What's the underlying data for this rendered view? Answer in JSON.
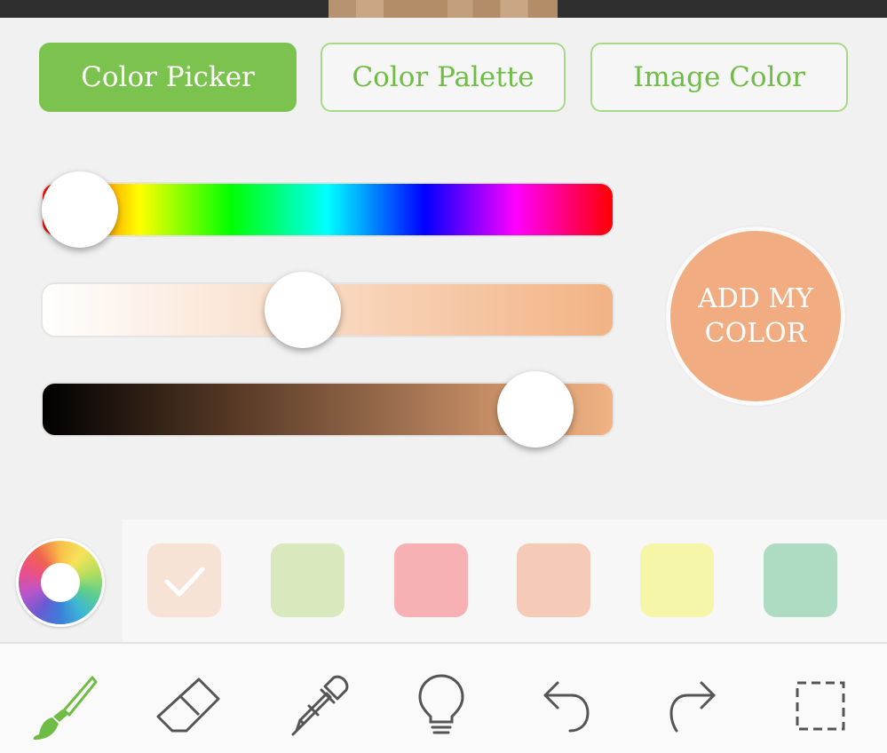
{
  "tabs": [
    {
      "label": "Color Picker",
      "active": true
    },
    {
      "label": "Color Palette",
      "active": false
    },
    {
      "label": "Image Color",
      "active": false
    }
  ],
  "sliders": {
    "hue": {
      "value": 0.0
    },
    "saturation": {
      "value": 0.45
    },
    "brightness": {
      "value": 0.92
    }
  },
  "selected_color": "#f1ad81",
  "add_button": {
    "label_line1": "ADD MY",
    "label_line2": "COLOR"
  },
  "palette": {
    "swatches": [
      {
        "color": "#f6e3d6",
        "selected": true
      },
      {
        "color": "#d9e8bd",
        "selected": false
      },
      {
        "color": "#f7b1b5",
        "selected": false
      },
      {
        "color": "#f5cbb8",
        "selected": false
      },
      {
        "color": "#f6f6a8",
        "selected": false
      },
      {
        "color": "#addcc3",
        "selected": false
      }
    ]
  },
  "toolbar": {
    "tools": [
      {
        "icon": "brush-icon",
        "active": true
      },
      {
        "icon": "eraser-icon",
        "active": false
      },
      {
        "icon": "eyedropper-icon",
        "active": false
      },
      {
        "icon": "lightbulb-icon",
        "active": false
      },
      {
        "icon": "undo-icon",
        "active": false
      },
      {
        "icon": "redo-icon",
        "active": false
      },
      {
        "icon": "select-area-icon",
        "active": false
      }
    ]
  },
  "colors": {
    "accent": "#7cc24f",
    "icon": "#555555"
  }
}
